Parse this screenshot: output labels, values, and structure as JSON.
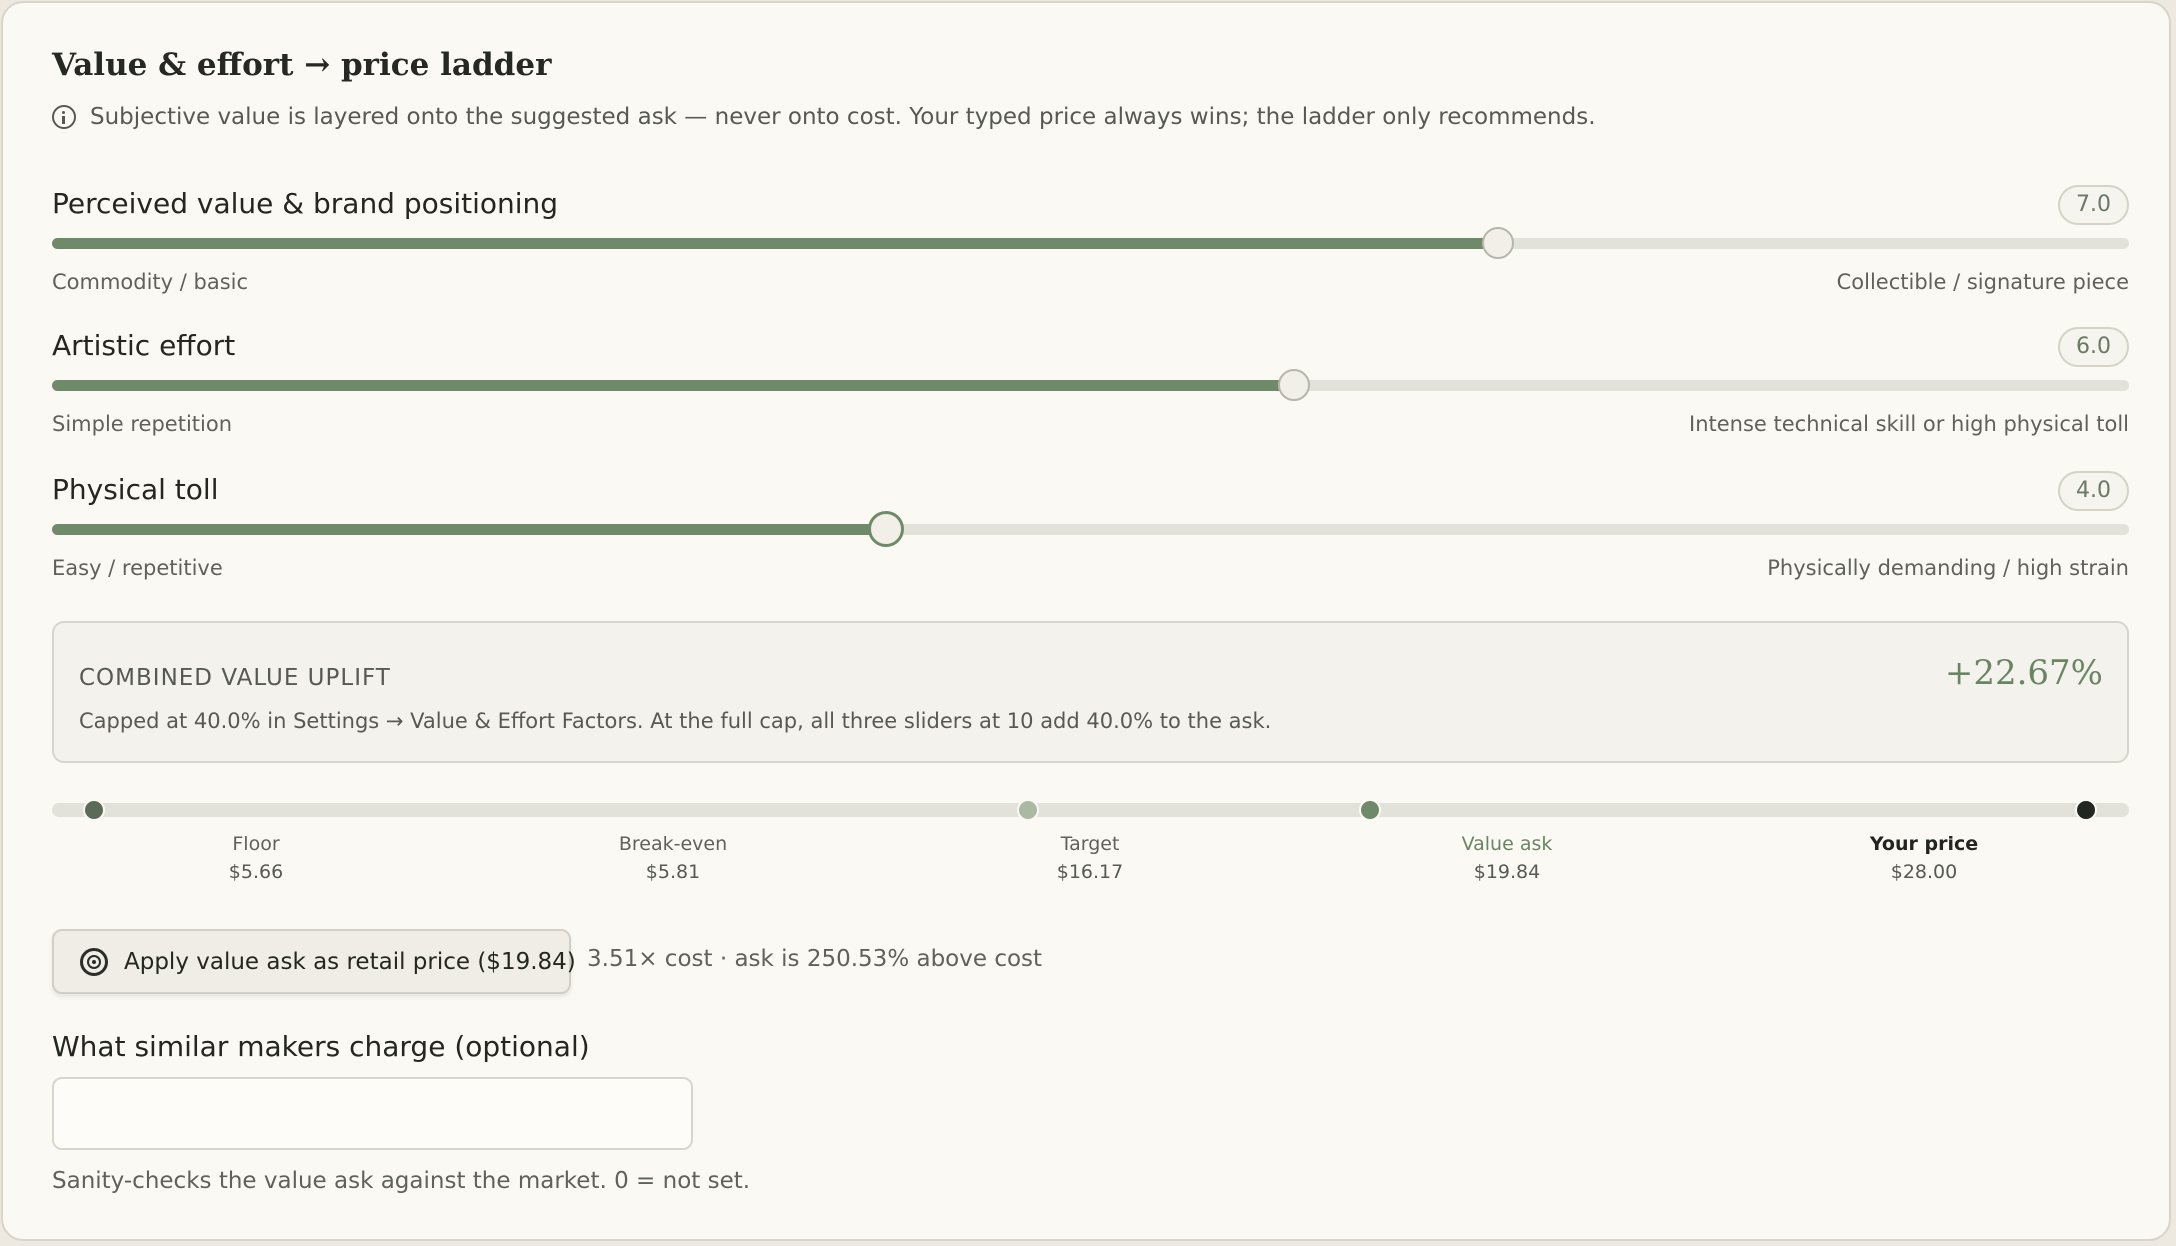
{
  "section": {
    "title": "Value & effort → price ladder",
    "note": "Subjective value is layered onto the suggested ask — never onto cost. Your typed price always wins; the ladder only recommends."
  },
  "sliders": [
    {
      "label": "Perceived value & brand positioning",
      "value": 7.0,
      "display": "7.0",
      "min_hint": "Commodity / basic",
      "max_hint": "Collectible / signature piece"
    },
    {
      "label": "Artistic effort",
      "value": 6.0,
      "display": "6.0",
      "min_hint": "Simple repetition",
      "max_hint": "Intense technical skill or high physical toll"
    },
    {
      "label": "Physical toll",
      "value": 4.0,
      "display": "4.0",
      "min_hint": "Easy / repetitive",
      "max_hint": "Physically demanding / high strain"
    }
  ],
  "uplift": {
    "label": "COMBINED VALUE UPLIFT",
    "value": "+22.67%",
    "description": "Capped at 40.0% in Settings → Value & Effort Factors. At the full cap, all three sliders at 10 add 40.0% to the ask."
  },
  "ladder": [
    {
      "name": "Floor",
      "price": "$5.66"
    },
    {
      "name": "Break-even",
      "price": "$5.81"
    },
    {
      "name": "Target",
      "price": "$16.17"
    },
    {
      "name": "Value ask",
      "price": "$19.84"
    },
    {
      "name": "Your price",
      "price": "$28.00"
    }
  ],
  "apply": {
    "label": "Apply value ask as retail price ($19.84)",
    "meta": "3.51× cost · ask is 250.53% above cost"
  },
  "market": {
    "label": "What similar makers charge (optional)",
    "value": "",
    "placeholder": "",
    "hint": "Sanity-checks the value ask against the market. 0 = not set."
  },
  "colors": {
    "accent": "#6f8a69",
    "background": "#fbf9f3",
    "track": "#e2e1da",
    "your_price_dot": "#232722"
  },
  "icons": {
    "note": "info-icon",
    "apply": "target-icon"
  }
}
